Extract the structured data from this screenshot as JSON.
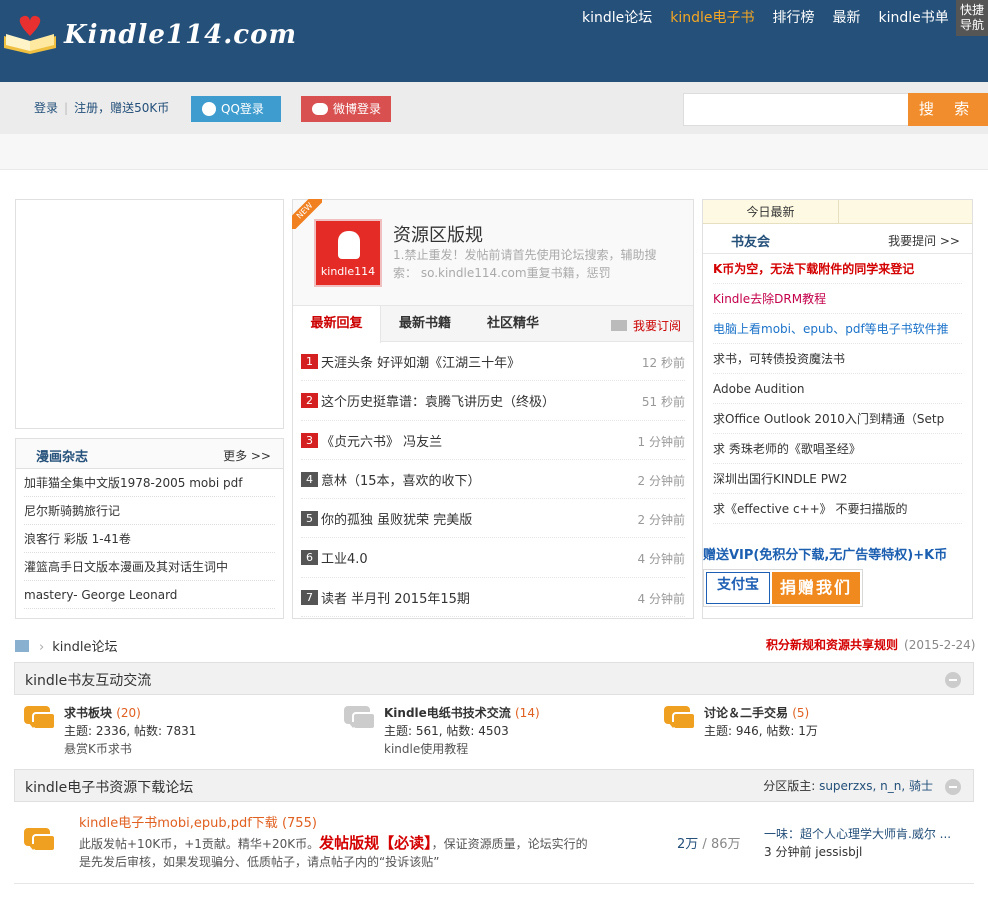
{
  "header": {
    "logo_text": "Kindle114.com",
    "nav": [
      "kindle论坛",
      "kindle电子书",
      "排行榜",
      "最新",
      "kindle书单"
    ],
    "nav_active_index": 1,
    "quick_nav": [
      "快捷",
      "导航"
    ]
  },
  "auth": {
    "login": "登录",
    "register": "注册，赠送50K币",
    "qq_login": "QQ登录",
    "weibo_login": "微博登录"
  },
  "search": {
    "placeholder": "",
    "button": "搜 索"
  },
  "manhua": {
    "title": "漫画杂志",
    "more": "更多 >>",
    "items": [
      "加菲猫全集中文版1978-2005 mobi pdf",
      "尼尔斯骑鹅旅行记",
      "浪客行 彩版 1-41卷",
      "灌篮高手日文版本漫画及其对话生词中",
      "mastery- George Leonard"
    ]
  },
  "center": {
    "new_tag": "NEW",
    "icon_label": "kindle114",
    "title": "资源区版规",
    "desc": "1.禁止重发！发帖前请首先使用论坛搜索，辅助搜索： so.kindle114.com重复书籍，惩罚",
    "tabs": [
      "最新回复",
      "最新书籍",
      "社区精华"
    ],
    "subscribe": "我要订阅",
    "items": [
      {
        "n": "1",
        "title": "天涯头条 好评如潮《江湖三十年》",
        "time": "12 秒前"
      },
      {
        "n": "2",
        "title": "这个历史挺靠谱：袁腾飞讲历史（终极）",
        "time": "51 秒前"
      },
      {
        "n": "3",
        "title": "《贞元六书》 冯友兰",
        "time": "1 分钟前"
      },
      {
        "n": "4",
        "title": "意林（15本，喜欢的收下）",
        "time": "2 分钟前"
      },
      {
        "n": "5",
        "title": "你的孤独 虽败犹荣 完美版",
        "time": "2 分钟前"
      },
      {
        "n": "6",
        "title": "工业4.0",
        "time": "4 分钟前"
      },
      {
        "n": "7",
        "title": "读者 半月刊 2015年15期",
        "time": "4 分钟前"
      }
    ]
  },
  "right": {
    "tab_today": "今日最新",
    "title": "书友会",
    "more": "我要提问 >>",
    "items": [
      {
        "text": "K币为空，无法下载附件的同学来登记",
        "style": "red"
      },
      {
        "text": "Kindle去除DRM教程",
        "style": "pink"
      },
      {
        "text": "电脑上看mobi、epub、pdf等电子书软件推",
        "style": "blue"
      },
      {
        "text": "求书，可转债投资魔法书",
        "style": ""
      },
      {
        "text": "Adobe Audition",
        "style": ""
      },
      {
        "text": "求Office Outlook 2010入门到精通（Setp",
        "style": ""
      },
      {
        "text": "求 秀珠老师的《歌唱圣经》",
        "style": ""
      },
      {
        "text": "深圳出国行KINDLE PW2",
        "style": ""
      },
      {
        "text": "求《effective c++》 不要扫描版的",
        "style": ""
      }
    ],
    "vip": "赠送VIP(免积分下载,无广告等特权)+K币",
    "alipay": "支付宝",
    "donate": "捐赠我们"
  },
  "breadcrumb": {
    "current": "kindle论坛",
    "rules": "积分新规和资源共享规则",
    "rules_date": "(2015-2-24)"
  },
  "section1": {
    "title": "kindle书友互动交流",
    "forums": [
      {
        "name": "求书板块",
        "count": "(20)",
        "stats": "主题: 2336, 帖数: 7831",
        "desc": "悬赏K币求书",
        "icon_color": "#f0a020"
      },
      {
        "name": "Kindle电纸书技术交流",
        "count": "(14)",
        "stats": "主题: 561, 帖数: 4503",
        "desc": "kindle使用教程",
        "icon_color": "#cccccc"
      },
      {
        "name": "讨论＆二手交易",
        "count": "(5)",
        "stats": "主题: 946, 帖数: 1万",
        "desc": "",
        "icon_color": "#f0a020"
      }
    ]
  },
  "section2": {
    "title": "kindle电子书资源下载论坛",
    "mods_label": "分区版主:",
    "mods": "superzxs, n_n, 骑士",
    "forum": {
      "name": "kindle电子书mobi,epub,pdf下载",
      "count": "(755)",
      "desc_a": "此版发帖+10K币，+1贡献。精华+20K币。",
      "desc_hl": "发帖版规【必读】",
      "desc_b": "，保证资源质量，论坛实行的是先发后审核，如果发现骗分、低质帖子，请点帖子内的“投诉该贴”",
      "threads": "2万",
      "posts": "86万",
      "last_post": "一味：超个人心理学大师肯.威尔 ...",
      "last_time": "3 分钟前 jessisbjl"
    }
  },
  "colors": {
    "header_bg": "#24507a",
    "accent_orange": "#f18d2c",
    "qq_blue": "#3e9ccf",
    "weibo_red": "#d85050",
    "rank_red": "#d42020"
  }
}
